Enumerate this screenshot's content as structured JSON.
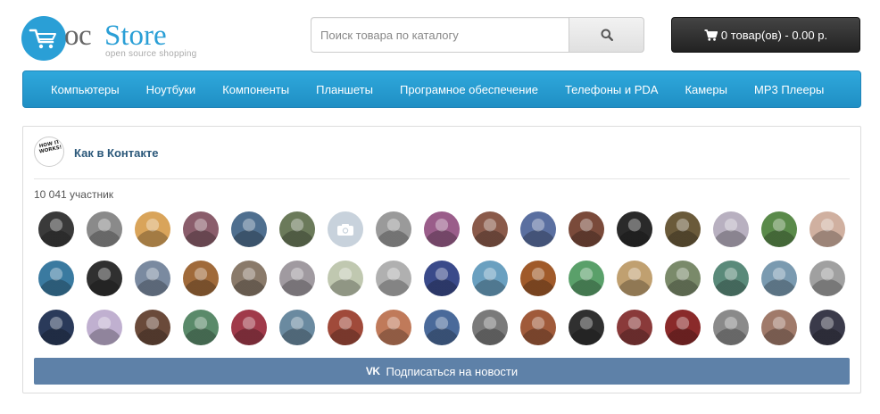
{
  "logo": {
    "oc": "oc",
    "store": "Store",
    "subtitle": "open source shopping"
  },
  "search": {
    "placeholder": "Поиск товара по каталогу",
    "icon": "search-icon"
  },
  "cart": {
    "label": "0 товар(ов) - 0.00 р.",
    "icon": "cart-icon"
  },
  "menu": {
    "items": [
      "Компьютеры",
      "Ноутбуки",
      "Компоненты",
      "Планшеты",
      "Програмное обеспечение",
      "Телефоны и PDA",
      "Камеры",
      "MP3 Плееры"
    ]
  },
  "widget": {
    "group_name": "Как в Контакте",
    "avatar_text": "HOW IT WORKS!",
    "members_count": "10 041 участник",
    "subscribe_label": "Подписаться на новости",
    "subscribe_icon": "vk-icon",
    "members": [
      "#3a3a3a",
      "#8a8a8a",
      "#d9a45a",
      "#8a5d6b",
      "#4f6f8f",
      "#6b7a5a",
      "placeholder",
      "#9a9a9a",
      "#9a5d8a",
      "#8a5a4a",
      "#5a6fa0",
      "#7a4a3a",
      "#2a2a2a",
      "#6a5a3a",
      "#b8b0c0",
      "#5a8a4a",
      "#d0b0a0",
      "#3a7aa0",
      "#303030",
      "#7a8aa0",
      "#a06a3a",
      "#8a7a6a",
      "#a09aa0",
      "#c0c8b0",
      "#b0b0b0",
      "#3a4a8a",
      "#6aa0c0",
      "#a05a2a",
      "#5aa06a",
      "#c0a070",
      "#7a8a6a",
      "#5a8a7a",
      "#7a9ab0",
      "#a0a0a0",
      "#2a3a5a",
      "#c0b0d0",
      "#6a4a3a",
      "#5a8a6a",
      "#a03a4a",
      "#6a8aa0",
      "#a04a3a",
      "#c07a5a",
      "#4a6a9a",
      "#7a7a7a",
      "#a05a3a",
      "#303030",
      "#8a3a3a",
      "#8a2a2a",
      "#8a8a8a",
      "#a07a6a",
      "#3a3a4a"
    ]
  }
}
